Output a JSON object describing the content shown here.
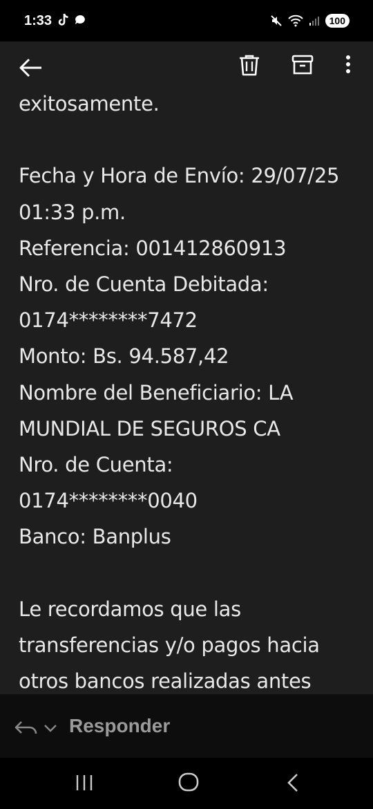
{
  "status_bar": {
    "time": "1:33",
    "battery": "100",
    "icons": [
      "tiktok-icon",
      "chat-icon",
      "mute-icon",
      "wifi-icon",
      "signal-icon"
    ]
  },
  "app_bar": {
    "actions": [
      "back-arrow-icon",
      "trash-icon",
      "archive-icon",
      "more-vert-icon"
    ]
  },
  "email_body": {
    "lines": [
      "exitosamente.",
      "",
      "Fecha y Hora de Envío: 29/07/25",
      "01:33 p.m.",
      "Referencia: 001412860913",
      "Nro. de Cuenta Debitada:",
      "0174********7472",
      "Monto: Bs. 94.587,42",
      "Nombre del Beneficiario: LA",
      "MUNDIAL DE SEGUROS CA",
      "Nro. de Cuenta:",
      "0174********0040",
      "Banco: Banplus",
      "",
      "Le recordamos que las",
      "transferencias y/o pagos hacia",
      "otros bancos realizadas antes"
    ]
  },
  "reply_bar": {
    "label": "Responder"
  },
  "nav_bar": {
    "buttons": [
      "recent-apps-icon",
      "home-icon",
      "back-icon"
    ]
  }
}
